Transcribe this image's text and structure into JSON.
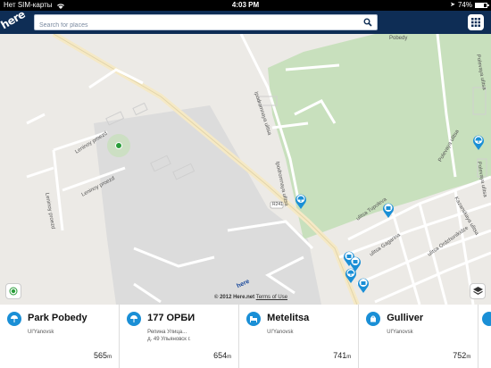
{
  "status_bar": {
    "carrier": "Нет SIM-карты",
    "time": "4:03 PM",
    "battery": "74%",
    "battery_level": 0.74
  },
  "search": {
    "placeholder": "Search for places"
  },
  "map": {
    "labels": {
      "area_pobedy": "Pobedy",
      "leninoy_proezd": "Leninoy proezd",
      "leninoy_proezd_2": "Leninoy proezd",
      "leninoy_proezd_3": "Leninoy proezd",
      "ipodromnaya_1": "Ipodromnaya ulitsa",
      "ipodromnaya_2": "Ipodromnaya ulitsa",
      "polevaya": "Polevaya ulitsa",
      "polevaya_2": "Polevaya ulitsa",
      "polevaya_3": "Polevaya ulitsa",
      "kazanskaya": "Kazanskaya ulitsa",
      "tupolev": "ulitsa Tupoleva",
      "gagarina": "ulitsa Gagarina",
      "ordzhonikidze": "ulitsa Ordzhonikidze",
      "route": "R241"
    },
    "copyright": "© 2012 Here.net",
    "terms": "Terms of Use"
  },
  "places": [
    {
      "name": "Park Pobedy",
      "address": "Ul'Yanovsk",
      "distance": "565",
      "unit": "m",
      "icon": "umbrella-icon"
    },
    {
      "name": "177 ОРБИ",
      "address_line1": "Репина Улица...",
      "address_line2": "д. 49 Ульяновск г.",
      "distance": "654",
      "unit": "m",
      "icon": "umbrella-icon"
    },
    {
      "name": "Metelitsa",
      "address": "Ul'Yanovsk",
      "distance": "741",
      "unit": "m",
      "icon": "bed-icon"
    },
    {
      "name": "Gulliver",
      "address": "Ul'Yanovsk",
      "distance": "752",
      "unit": "m",
      "icon": "shopping-bag-icon"
    }
  ],
  "colors": {
    "header": "#0e2d55",
    "accent": "#1a8fd6",
    "park": "#c8e0bd",
    "map_bg": "#eceae6",
    "built": "#dcdcdc"
  }
}
